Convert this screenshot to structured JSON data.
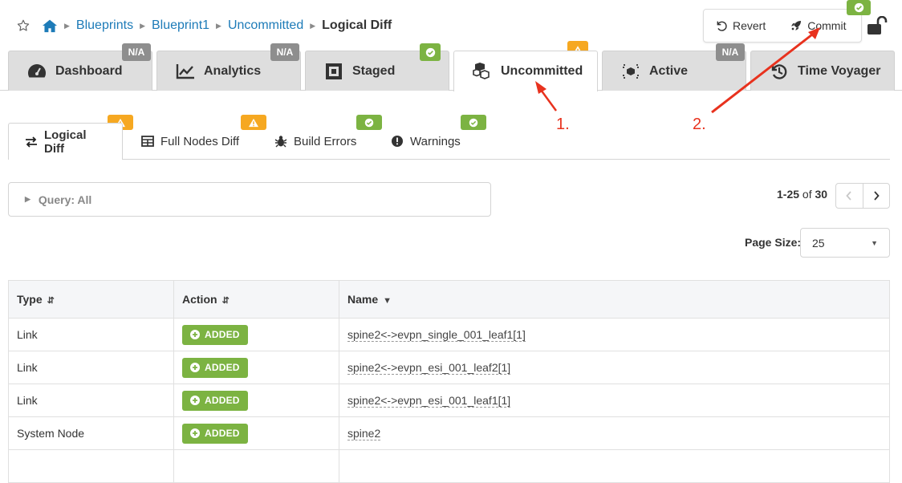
{
  "breadcrumb": {
    "items": [
      "Blueprints",
      "Blueprint1",
      "Uncommitted"
    ],
    "current": "Logical Diff"
  },
  "actions": {
    "revert_label": "Revert",
    "commit_label": "Commit"
  },
  "tabs": [
    {
      "label": "Dashboard",
      "icon": "dashboard-icon",
      "badge": "N/A"
    },
    {
      "label": "Analytics",
      "icon": "chart-line-icon",
      "badge": "N/A"
    },
    {
      "label": "Staged",
      "icon": "staged-icon",
      "badge": "check"
    },
    {
      "label": "Uncommitted",
      "icon": "cubes-icon",
      "badge": "warning",
      "active": true
    },
    {
      "label": "Active",
      "icon": "active-icon",
      "badge": "N/A"
    },
    {
      "label": "Time Voyager",
      "icon": "history-icon"
    }
  ],
  "subtabs": [
    {
      "label": "Logical Diff",
      "icon": "exchange-icon",
      "badge": "warning",
      "active": true
    },
    {
      "label": "Full Nodes Diff",
      "icon": "table-icon",
      "badge": "warning"
    },
    {
      "label": "Build Errors",
      "icon": "bug-icon",
      "badge": "check"
    },
    {
      "label": "Warnings",
      "icon": "exclamation-icon",
      "badge": "check"
    }
  ],
  "query": {
    "label": "Query: All"
  },
  "pagination": {
    "range": "1-25",
    "of": "of",
    "total": "30",
    "page_size_label": "Page Size:",
    "page_size": "25"
  },
  "table": {
    "columns": [
      "Type",
      "Action",
      "Name"
    ],
    "rows": [
      {
        "type": "Link",
        "action": "ADDED",
        "name": "spine2<->evpn_single_001_leaf1[1]"
      },
      {
        "type": "Link",
        "action": "ADDED",
        "name": "spine2<->evpn_esi_001_leaf2[1]"
      },
      {
        "type": "Link",
        "action": "ADDED",
        "name": "spine2<->evpn_esi_001_leaf1[1]"
      },
      {
        "type": "System Node",
        "action": "ADDED",
        "name": "spine2"
      }
    ]
  },
  "annotations": {
    "step1": "1.",
    "step2": "2."
  },
  "colors": {
    "link": "#1d7bb8",
    "green": "#7cb342",
    "warning": "#f6a821",
    "annotation": "#e8321e"
  }
}
